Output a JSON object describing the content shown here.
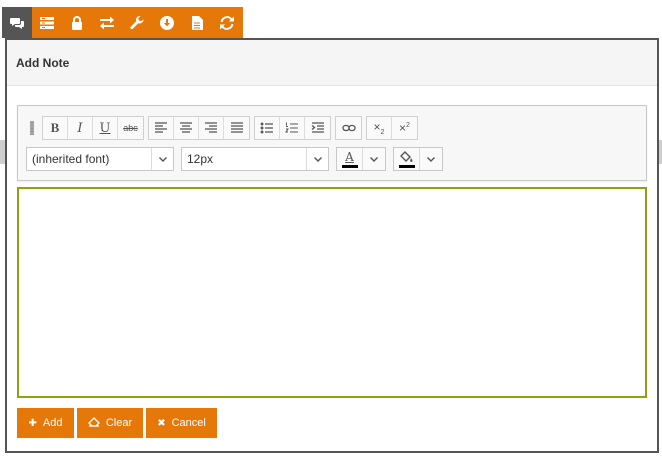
{
  "toolbar": {
    "icons": [
      "comments-icon",
      "list-icon",
      "lock-icon",
      "exchange-icon",
      "wrench-icon",
      "download-icon",
      "document-icon",
      "refresh-icon"
    ],
    "active": "comments-icon",
    "color": "#e6780a"
  },
  "dialog": {
    "title": "Add Note"
  },
  "editor": {
    "toolbar": {
      "format_buttons": [
        {
          "name": "bold",
          "glyph": "B"
        },
        {
          "name": "italic",
          "glyph": "I"
        },
        {
          "name": "underline",
          "glyph": "U"
        },
        {
          "name": "strikethrough",
          "glyph": "abc"
        }
      ],
      "font_family": "(inherited font)",
      "font_size": "12px",
      "font_color_glyph": "A"
    },
    "content": "",
    "border_color": "#8ba30f"
  },
  "actions": {
    "add_label": "Add",
    "clear_label": "Clear",
    "cancel_label": "Cancel"
  }
}
